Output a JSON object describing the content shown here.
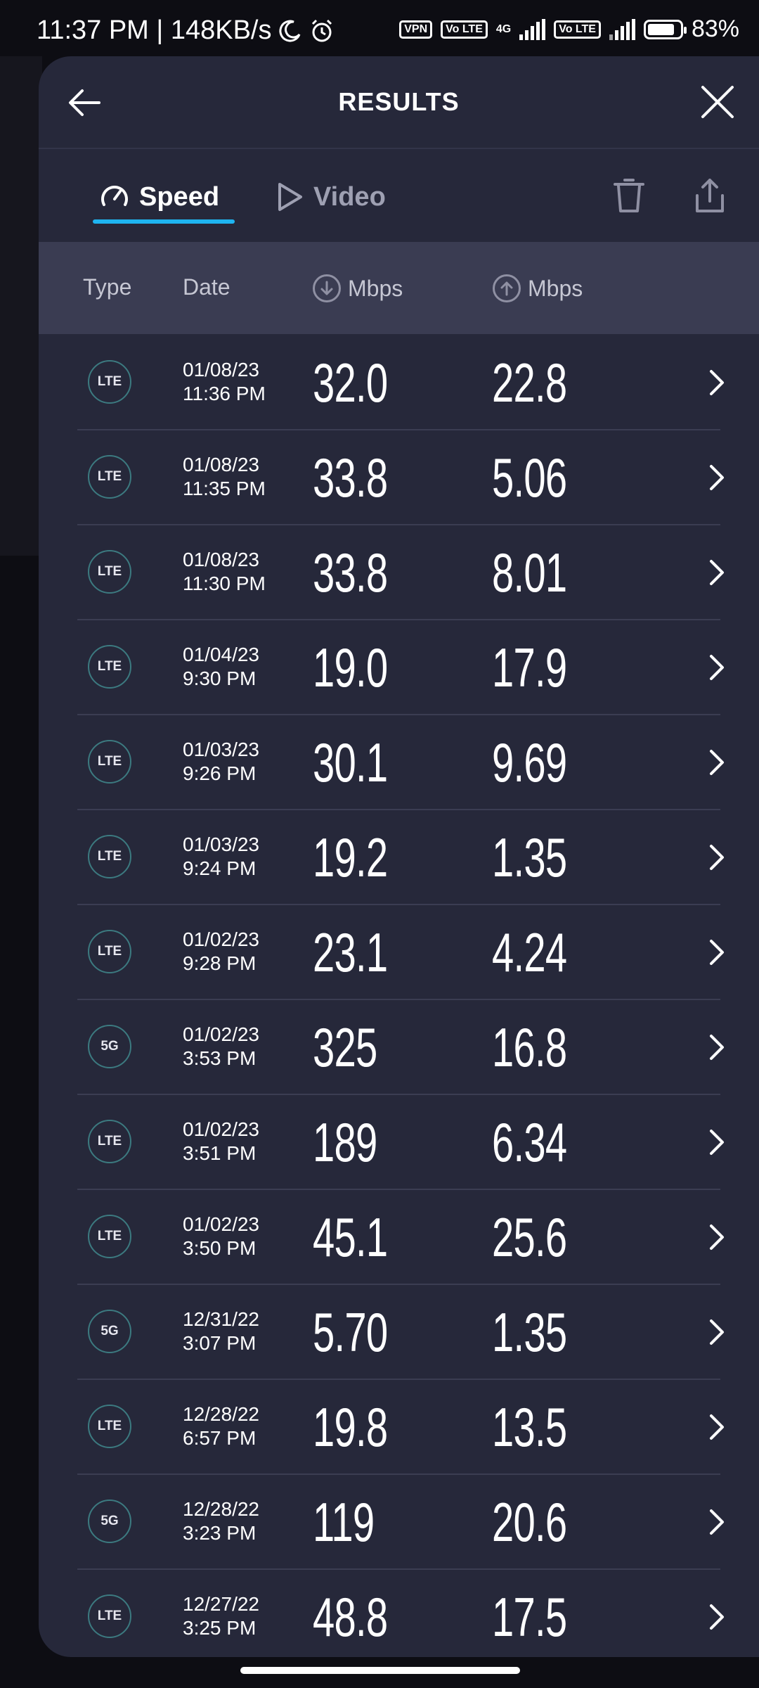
{
  "status_bar": {
    "time": "11:37 PM | 148KB/s",
    "badges": [
      "VPN",
      "Vo LTE",
      "4G",
      "Vo LTE"
    ],
    "battery": "83%",
    "battery_level": 0.83
  },
  "header": {
    "title": "RESULTS"
  },
  "tabs": [
    {
      "label": "Speed",
      "active": true
    },
    {
      "label": "Video",
      "active": false
    }
  ],
  "columns": {
    "type": "Type",
    "date": "Date",
    "download_unit": "Mbps",
    "upload_unit": "Mbps"
  },
  "colors": {
    "accent": "#1eb4f0",
    "sheet": "#26283a",
    "header_row": "#3a3c52"
  },
  "results": [
    {
      "type": "LTE",
      "date": "01/08/23",
      "time": "11:36 PM",
      "down": "32.0",
      "up": "22.8"
    },
    {
      "type": "LTE",
      "date": "01/08/23",
      "time": "11:35 PM",
      "down": "33.8",
      "up": "5.06"
    },
    {
      "type": "LTE",
      "date": "01/08/23",
      "time": "11:30 PM",
      "down": "33.8",
      "up": "8.01"
    },
    {
      "type": "LTE",
      "date": "01/04/23",
      "time": "9:30 PM",
      "down": "19.0",
      "up": "17.9"
    },
    {
      "type": "LTE",
      "date": "01/03/23",
      "time": "9:26 PM",
      "down": "30.1",
      "up": "9.69"
    },
    {
      "type": "LTE",
      "date": "01/03/23",
      "time": "9:24 PM",
      "down": "19.2",
      "up": "1.35"
    },
    {
      "type": "LTE",
      "date": "01/02/23",
      "time": "9:28 PM",
      "down": "23.1",
      "up": "4.24"
    },
    {
      "type": "5G",
      "date": "01/02/23",
      "time": "3:53 PM",
      "down": "325",
      "up": "16.8"
    },
    {
      "type": "LTE",
      "date": "01/02/23",
      "time": "3:51 PM",
      "down": "189",
      "up": "6.34"
    },
    {
      "type": "LTE",
      "date": "01/02/23",
      "time": "3:50 PM",
      "down": "45.1",
      "up": "25.6"
    },
    {
      "type": "5G",
      "date": "12/31/22",
      "time": "3:07 PM",
      "down": "5.70",
      "up": "1.35"
    },
    {
      "type": "LTE",
      "date": "12/28/22",
      "time": "6:57 PM",
      "down": "19.8",
      "up": "13.5"
    },
    {
      "type": "5G",
      "date": "12/28/22",
      "time": "3:23 PM",
      "down": "119",
      "up": "20.6"
    },
    {
      "type": "LTE",
      "date": "12/27/22",
      "time": "3:25 PM",
      "down": "48.8",
      "up": "17.5"
    }
  ]
}
